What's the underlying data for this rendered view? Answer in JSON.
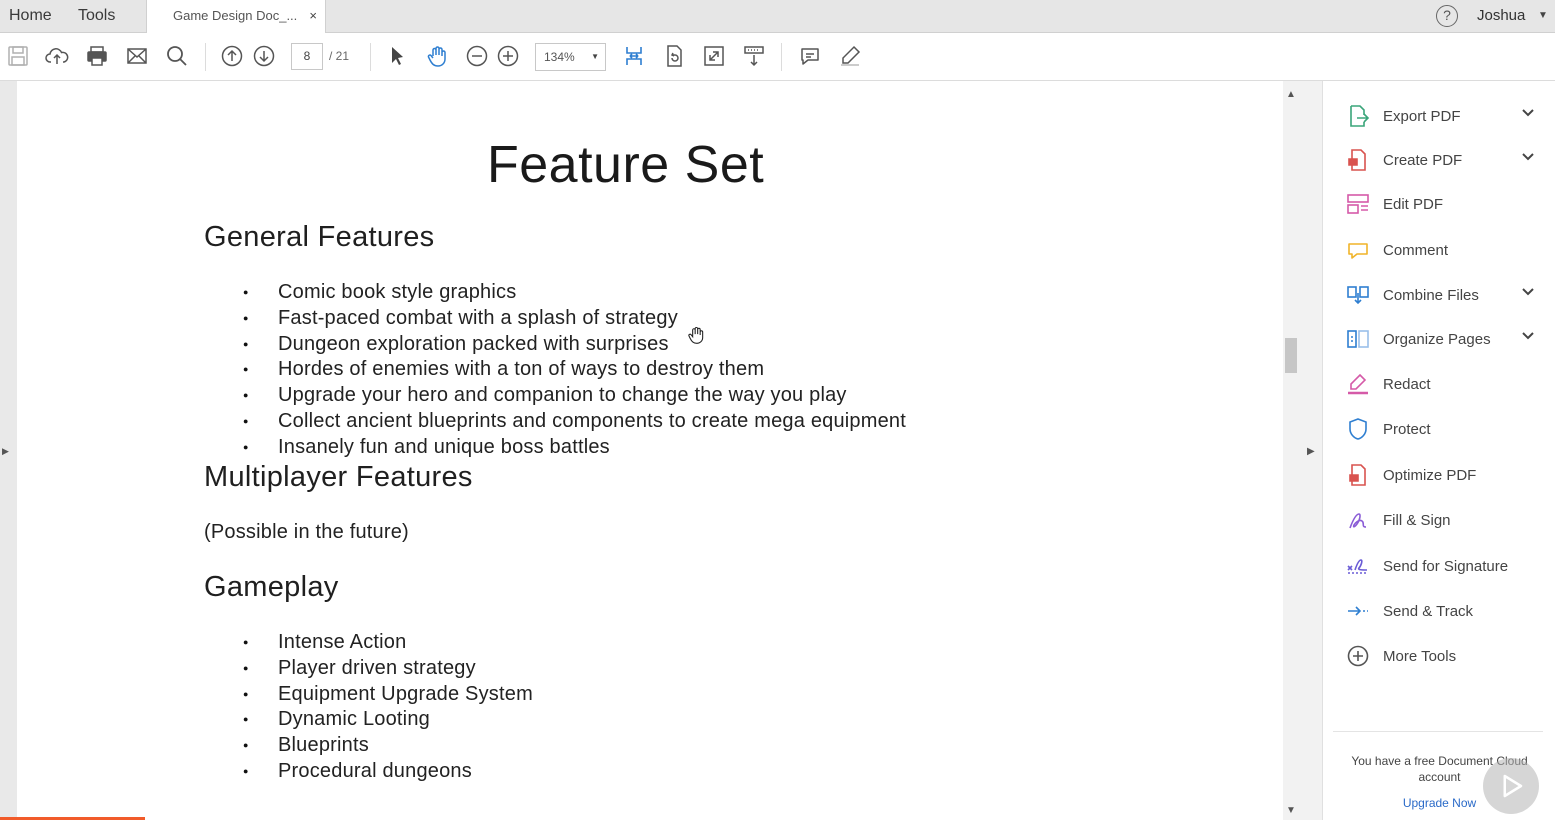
{
  "tabs": {
    "home": "Home",
    "tools": "Tools",
    "document": "Game Design Doc_...",
    "close": "×"
  },
  "user": {
    "name": "Joshua",
    "help": "?"
  },
  "toolbar": {
    "current_page": "8",
    "total_pages": "/ 21",
    "zoom": "134%"
  },
  "document": {
    "title": "Feature Set",
    "sections": {
      "general": {
        "heading": "General Features",
        "bullets": [
          "Comic book style graphics",
          "Fast-paced combat with a splash of strategy",
          "Dungeon exploration packed with surprises",
          "Hordes of enemies with a ton of ways to destroy them",
          "Upgrade your hero and companion to change the way you play",
          "Collect ancient blueprints and components to create mega equipment",
          "Insanely fun and unique boss battles"
        ]
      },
      "multiplayer": {
        "heading": "Multiplayer Features",
        "note": "(Possible in the future)"
      },
      "gameplay": {
        "heading": "Gameplay",
        "bullets": [
          "Intense Action",
          "Player driven strategy",
          "Equipment Upgrade System",
          "Dynamic Looting",
          "Blueprints",
          "Procedural dungeons"
        ]
      }
    }
  },
  "tools_panel": {
    "items": [
      {
        "label": "Export PDF",
        "icon": "export-pdf-icon",
        "color": "#3aa57a"
      },
      {
        "label": "Create PDF",
        "icon": "create-pdf-icon",
        "color": "#d9534f"
      },
      {
        "label": "Edit PDF",
        "icon": "edit-pdf-icon",
        "color": "#d55aa8"
      },
      {
        "label": "Comment",
        "icon": "comment-icon",
        "color": "#f0b429"
      },
      {
        "label": "Combine Files",
        "icon": "combine-files-icon",
        "color": "#2f7fd1"
      },
      {
        "label": "Organize Pages",
        "icon": "organize-pages-icon",
        "color": "#2f7fd1"
      },
      {
        "label": "Redact",
        "icon": "redact-icon",
        "color": "#d55aa8"
      },
      {
        "label": "Protect",
        "icon": "protect-icon",
        "color": "#2f7fd1"
      },
      {
        "label": "Optimize PDF",
        "icon": "optimize-pdf-icon",
        "color": "#d9534f"
      },
      {
        "label": "Fill & Sign",
        "icon": "fill-sign-icon",
        "color": "#8a5cd6"
      },
      {
        "label": "Send for Signature",
        "icon": "send-signature-icon",
        "color": "#6a5cd6"
      },
      {
        "label": "Send & Track",
        "icon": "send-track-icon",
        "color": "#2f7fd1"
      },
      {
        "label": "More Tools",
        "icon": "more-tools-icon",
        "color": "#555555"
      }
    ],
    "cloud_message": "You have a free Document Cloud account",
    "upgrade_label": "Upgrade Now"
  },
  "colors": {
    "accent_blue": "#2f7fd1",
    "progress_orange": "#f15b2a"
  }
}
